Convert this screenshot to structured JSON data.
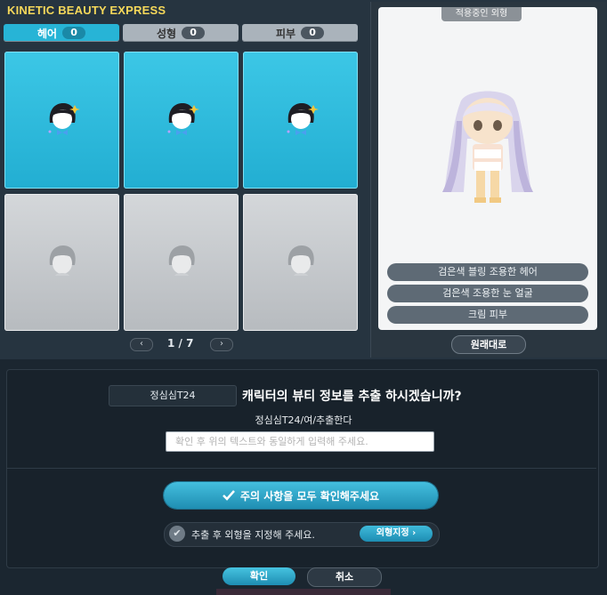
{
  "window": {
    "title": "KINETIC BEAUTY EXPRESS"
  },
  "tabs": [
    {
      "label": "헤어",
      "count": "0"
    },
    {
      "label": "성형",
      "count": "0"
    },
    {
      "label": "피부",
      "count": "0"
    }
  ],
  "grid": {
    "items": [
      {
        "state": "available"
      },
      {
        "state": "available"
      },
      {
        "state": "available"
      },
      {
        "state": "empty"
      },
      {
        "state": "empty"
      },
      {
        "state": "empty"
      }
    ]
  },
  "pagination": {
    "prev": "‹",
    "page": "1 / 7",
    "next": "›"
  },
  "preview": {
    "label": "적용중인 외형",
    "looks": [
      "검은색 블링 조용한 헤어",
      "검은색 조용한 눈 얼굴",
      "크림 피부"
    ],
    "reset_label": "원래대로"
  },
  "dialog": {
    "character_name": "정심심T24",
    "question": "캐릭터의 뷰티 정보를 추출 하시겠습니까?",
    "instruction": "정심심T24/여/추출한다",
    "input_placeholder": "확인 후 위의 텍스트와 동일하게 입력해 주세요.",
    "input_value": "",
    "notice_button": "주의 사항을 모두 확인해주세요",
    "set_look_text": "추출 후 외형을 지정해 주세요.",
    "designate_button": "외형지정",
    "ok_button": "확인",
    "cancel_button": "취소"
  },
  "colors": {
    "accent": "#27b4d6",
    "title": "#f6d85a",
    "panel": "#263440"
  }
}
